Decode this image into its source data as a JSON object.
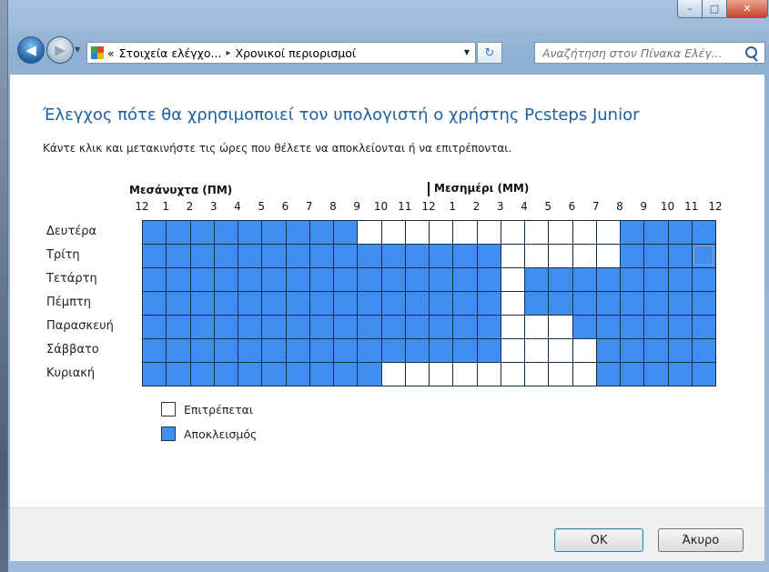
{
  "window": {
    "controls": {
      "minimize": "–",
      "maximize": "□",
      "close": "✕"
    }
  },
  "nav": {
    "breadcrumb_prefix": "«",
    "breadcrumb": [
      "Στοιχεία ελέγχο...",
      "Χρονικοί περιορισμοί"
    ],
    "breadcrumb_sep": "▸",
    "search_placeholder": "Αναζήτηση στον Πίνακα Ελέγ..."
  },
  "main": {
    "title": "Έλεγχος πότε θα χρησιμοποιεί τον υπολογιστή ο χρήστης Pcsteps Junior",
    "subtitle": "Κάντε κλικ και μετακινήστε τις ώρες που θέλετε να αποκλείονται ή να επιτρέπονται.",
    "midnight_label": "Μεσάνυχτα (ΠΜ)",
    "noon_label": "Μεσημέρι (ΜΜ)",
    "hours": [
      "12",
      "1",
      "2",
      "3",
      "4",
      "5",
      "6",
      "7",
      "8",
      "9",
      "10",
      "11",
      "12",
      "1",
      "2",
      "3",
      "4",
      "5",
      "6",
      "7",
      "8",
      "9",
      "10",
      "11",
      "12"
    ],
    "days": [
      "Δευτέρα",
      "Τρίτη",
      "Τετάρτη",
      "Πέμπτη",
      "Παρασκευή",
      "Σάββατο",
      "Κυριακή"
    ],
    "schedule": [
      "BBBBBBBBBAAAAAAAAAAABBBB",
      "BBBBBBBBBBBBBBBAAAAABBBB",
      "BBBBBBBBBBBBBBBABBBBBBBB",
      "BBBBBBBBBBBBBBBABBBBBBBB",
      "BBBBBBBBBBBBBBBAAABBBBBB",
      "BBBBBBBBBBBBBBBAAAABBBBB",
      "BBBBBBBBBBAAAAAAAAABBBBB"
    ],
    "legend": {
      "allowed": "Επιτρέπεται",
      "blocked": "Αποκλεισμός"
    },
    "colors": {
      "blocked": "#3f8ff0",
      "allowed": "#ffffff",
      "title": "#1e5fa0"
    }
  },
  "footer": {
    "ok_label": "OK",
    "cancel_label": "Άκυρο"
  }
}
